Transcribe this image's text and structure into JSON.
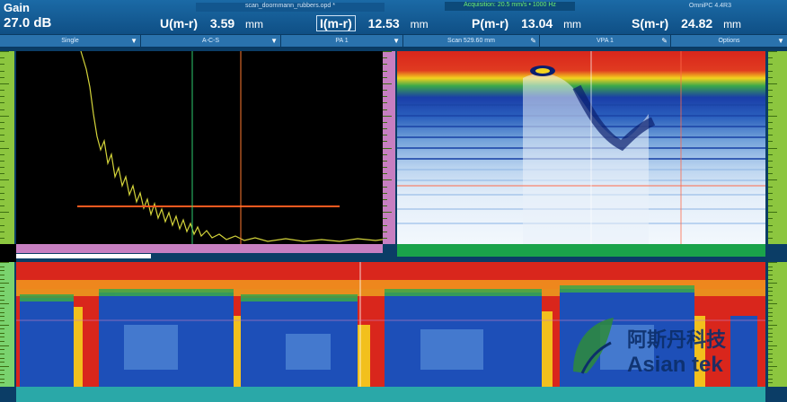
{
  "header": {
    "gain_label": "Gain",
    "gain_value": "27.0 dB",
    "file_name": "scan_doornmann_rubbers.opd *",
    "status_text": "Acquisition: 20.5 mm/s • 1000 Hz",
    "device_text": "OmniPC 4.4R3",
    "measurements": [
      {
        "label": "U(m-r)",
        "value": "3.59",
        "unit": "mm"
      },
      {
        "label": "I(m-r)",
        "value": "12.53",
        "unit": "mm"
      },
      {
        "label": "P(m-r)",
        "value": "13.04",
        "unit": "mm"
      },
      {
        "label": "S(m-r)",
        "value": "24.82",
        "unit": "mm"
      }
    ]
  },
  "toolbar": {
    "buttons": [
      {
        "label": "Single",
        "icon": "chevron-down-icon"
      },
      {
        "label": "A-C-S",
        "icon": "chevron-down-icon"
      },
      {
        "label": "PA 1",
        "icon": "chevron-down-icon"
      },
      {
        "label": "Scan 529.60 mm",
        "icon": "pencil-icon"
      },
      {
        "label": "VPA 1",
        "icon": "pencil-icon"
      },
      {
        "label": "Options",
        "icon": "chevron-down-icon"
      }
    ]
  },
  "colors": {
    "header_bg": "#1b6aa6",
    "toolbar_btn": "#2a72ad",
    "ruler_green": "#8cc63f",
    "gate_orange": "#ff5a1f",
    "cursor_green": "#2ecc71",
    "ascan_trace": "#d4d43a"
  },
  "watermark": {
    "chinese": "阿斯丹科技",
    "latin": "Asian tek"
  }
}
